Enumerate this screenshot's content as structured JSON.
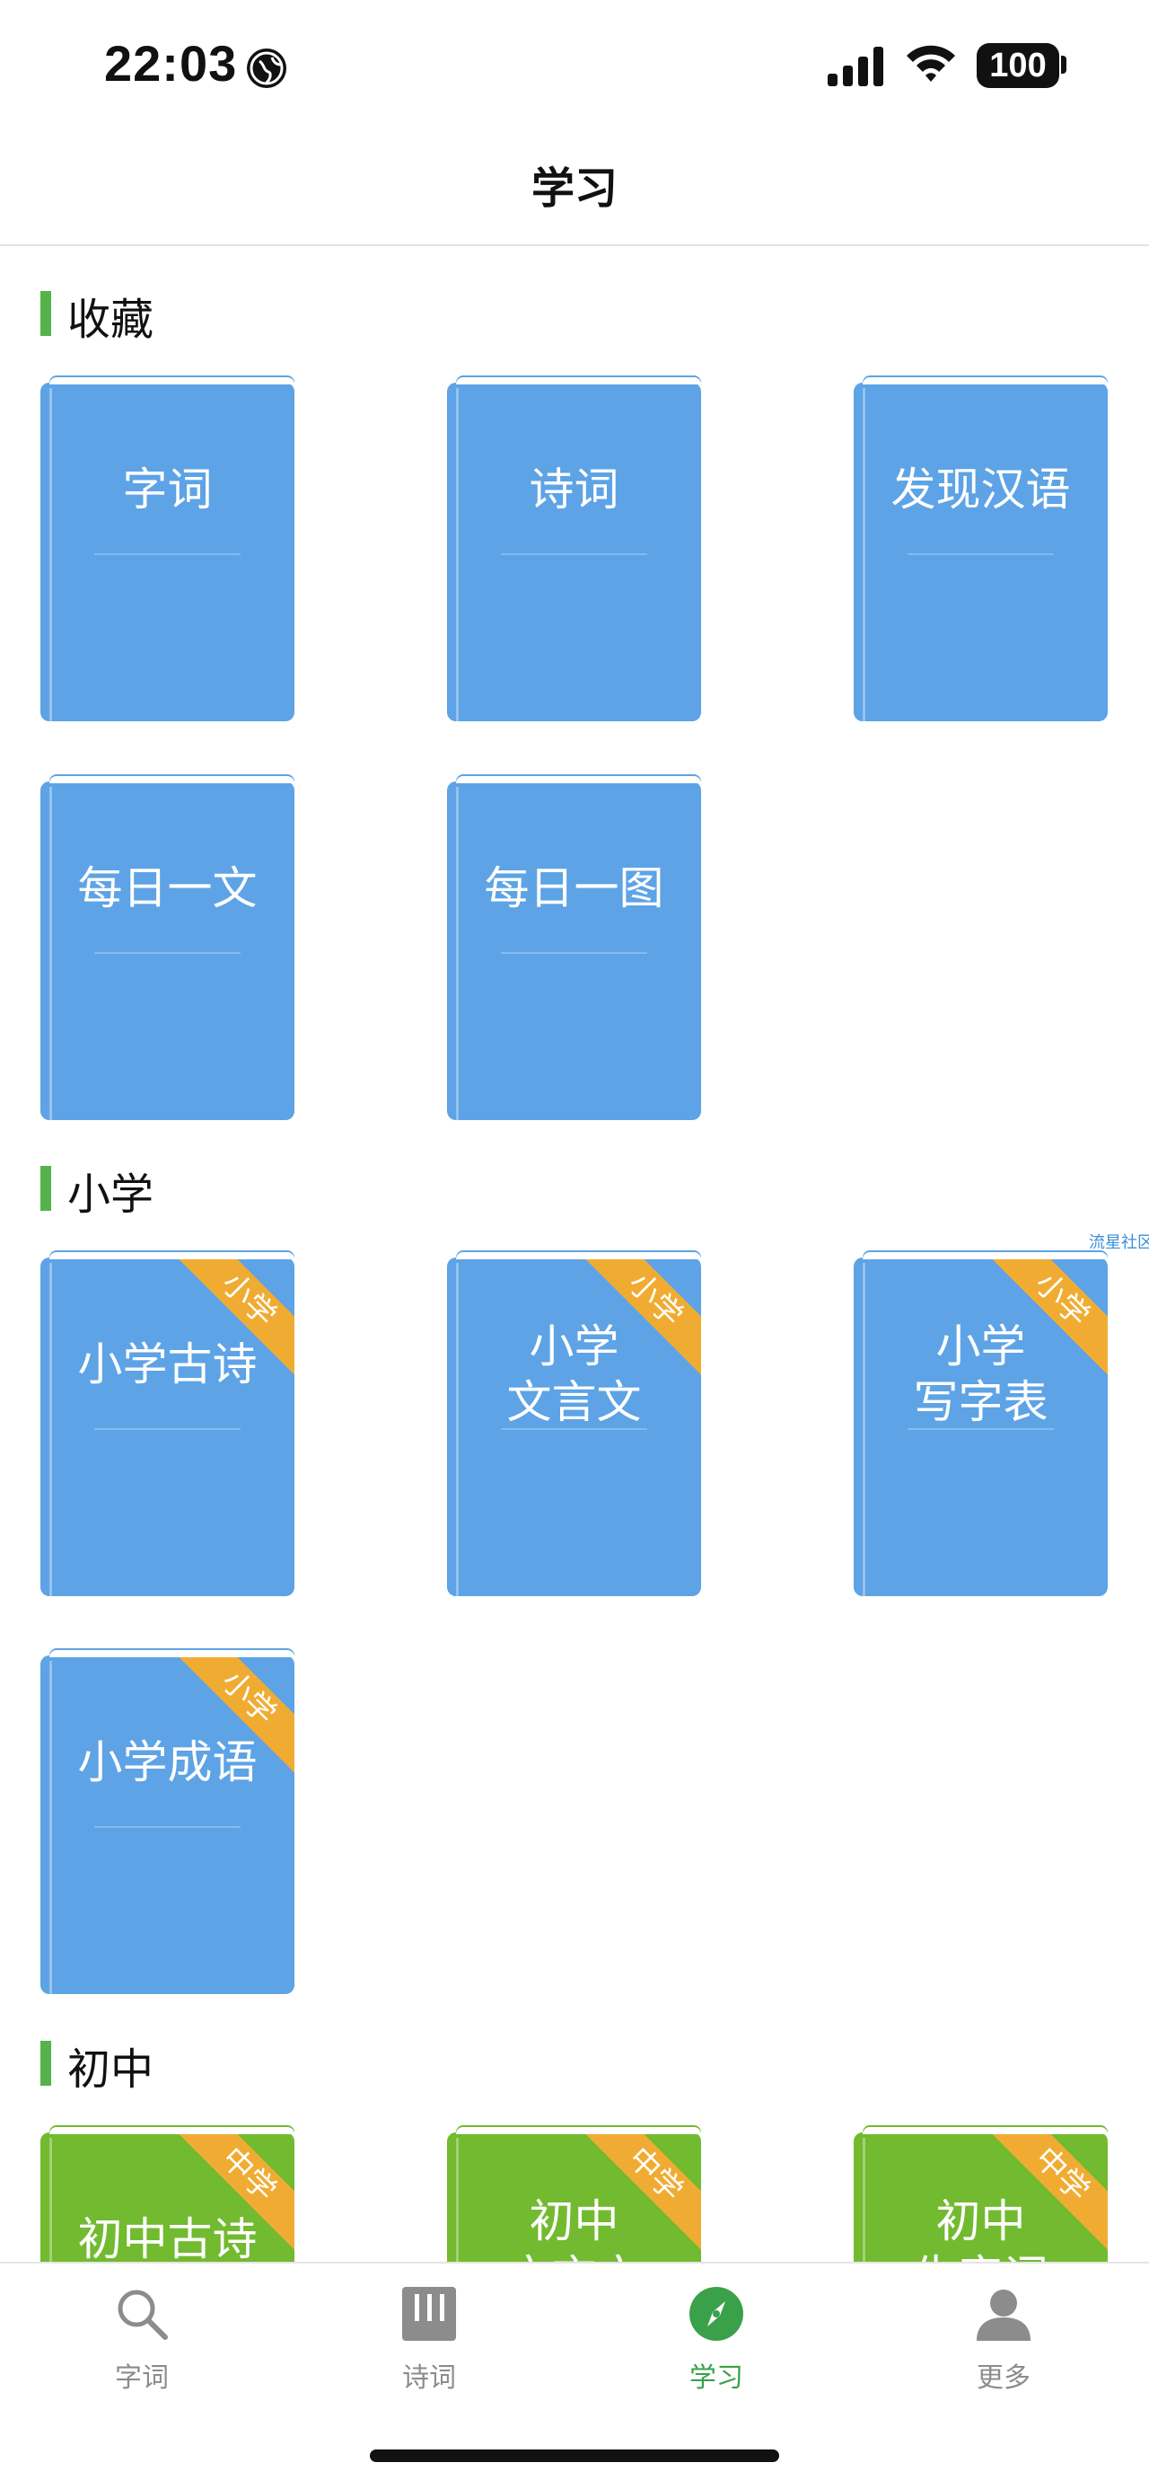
{
  "status_bar": {
    "time": "22:03",
    "battery": "100"
  },
  "nav": {
    "title": "学习"
  },
  "sections": [
    {
      "title": "收藏",
      "books": [
        "字词",
        "诗词",
        "发现汉语",
        "每日一文",
        "每日一图"
      ]
    },
    {
      "title": "小学",
      "badge": "小学",
      "books": [
        "小学古诗",
        "小学\n文言文",
        "小学\n写字表",
        "小学成语"
      ]
    },
    {
      "title": "初中",
      "badge": "中学",
      "books": [
        "初中古诗",
        "初中\n文言文",
        "初中\n生字词"
      ]
    }
  ],
  "watermark": "流星社区",
  "tabs": [
    {
      "label": "字词",
      "icon": "search-icon",
      "active": false
    },
    {
      "label": "诗词",
      "icon": "book-icon",
      "active": false
    },
    {
      "label": "学习",
      "icon": "compass-icon",
      "active": true
    },
    {
      "label": "更多",
      "icon": "person-icon",
      "active": false
    }
  ],
  "colors": {
    "accent": "#3aa14a",
    "section_bar": "#55b34a",
    "book_blue": "#5da3e6",
    "book_green": "#72ba2f",
    "ribbon": "#f0ac32"
  }
}
